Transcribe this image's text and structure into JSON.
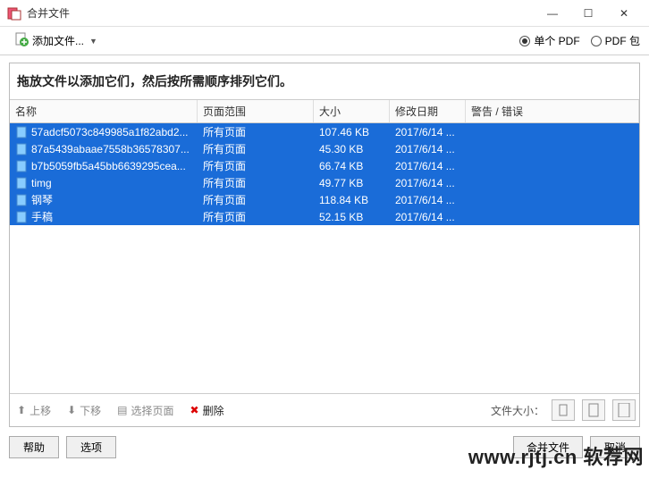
{
  "window": {
    "title": "合并文件",
    "minimize": "—",
    "maximize": "☐",
    "close": "✕"
  },
  "toolbar": {
    "add_label": "添加文件...",
    "radio_single": "单个 PDF",
    "radio_package": "PDF 包"
  },
  "hint": "拖放文件以添加它们，然后按所需顺序排列它们。",
  "columns": {
    "name": "名称",
    "range": "页面范围",
    "size": "大小",
    "date": "修改日期",
    "warn": "警告 / 错误"
  },
  "rows": [
    {
      "name": "57adcf5073c849985a1f82abd2...",
      "range": "所有页面",
      "size": "107.46 KB",
      "date": "2017/6/14 ...",
      "warn": ""
    },
    {
      "name": "87a5439abaae7558b36578307...",
      "range": "所有页面",
      "size": "45.30 KB",
      "date": "2017/6/14 ...",
      "warn": ""
    },
    {
      "name": "b7b5059fb5a45bb6639295cea...",
      "range": "所有页面",
      "size": "66.74 KB",
      "date": "2017/6/14 ...",
      "warn": ""
    },
    {
      "name": "timg",
      "range": "所有页面",
      "size": "49.77 KB",
      "date": "2017/6/14 ...",
      "warn": ""
    },
    {
      "name": "钢琴",
      "range": "所有页面",
      "size": "118.84 KB",
      "date": "2017/6/14 ...",
      "warn": ""
    },
    {
      "name": "手稿",
      "range": "所有页面",
      "size": "52.15 KB",
      "date": "2017/6/14 ...",
      "warn": ""
    }
  ],
  "actions": {
    "up": "上移",
    "down": "下移",
    "select_pages": "选择页面",
    "delete": "删除",
    "filesize_label": "文件大小："
  },
  "buttons": {
    "help": "帮助",
    "options": "选项",
    "merge": "合并文件",
    "cancel": "取消"
  },
  "watermark": "www.rjtj.cn 软荐网"
}
